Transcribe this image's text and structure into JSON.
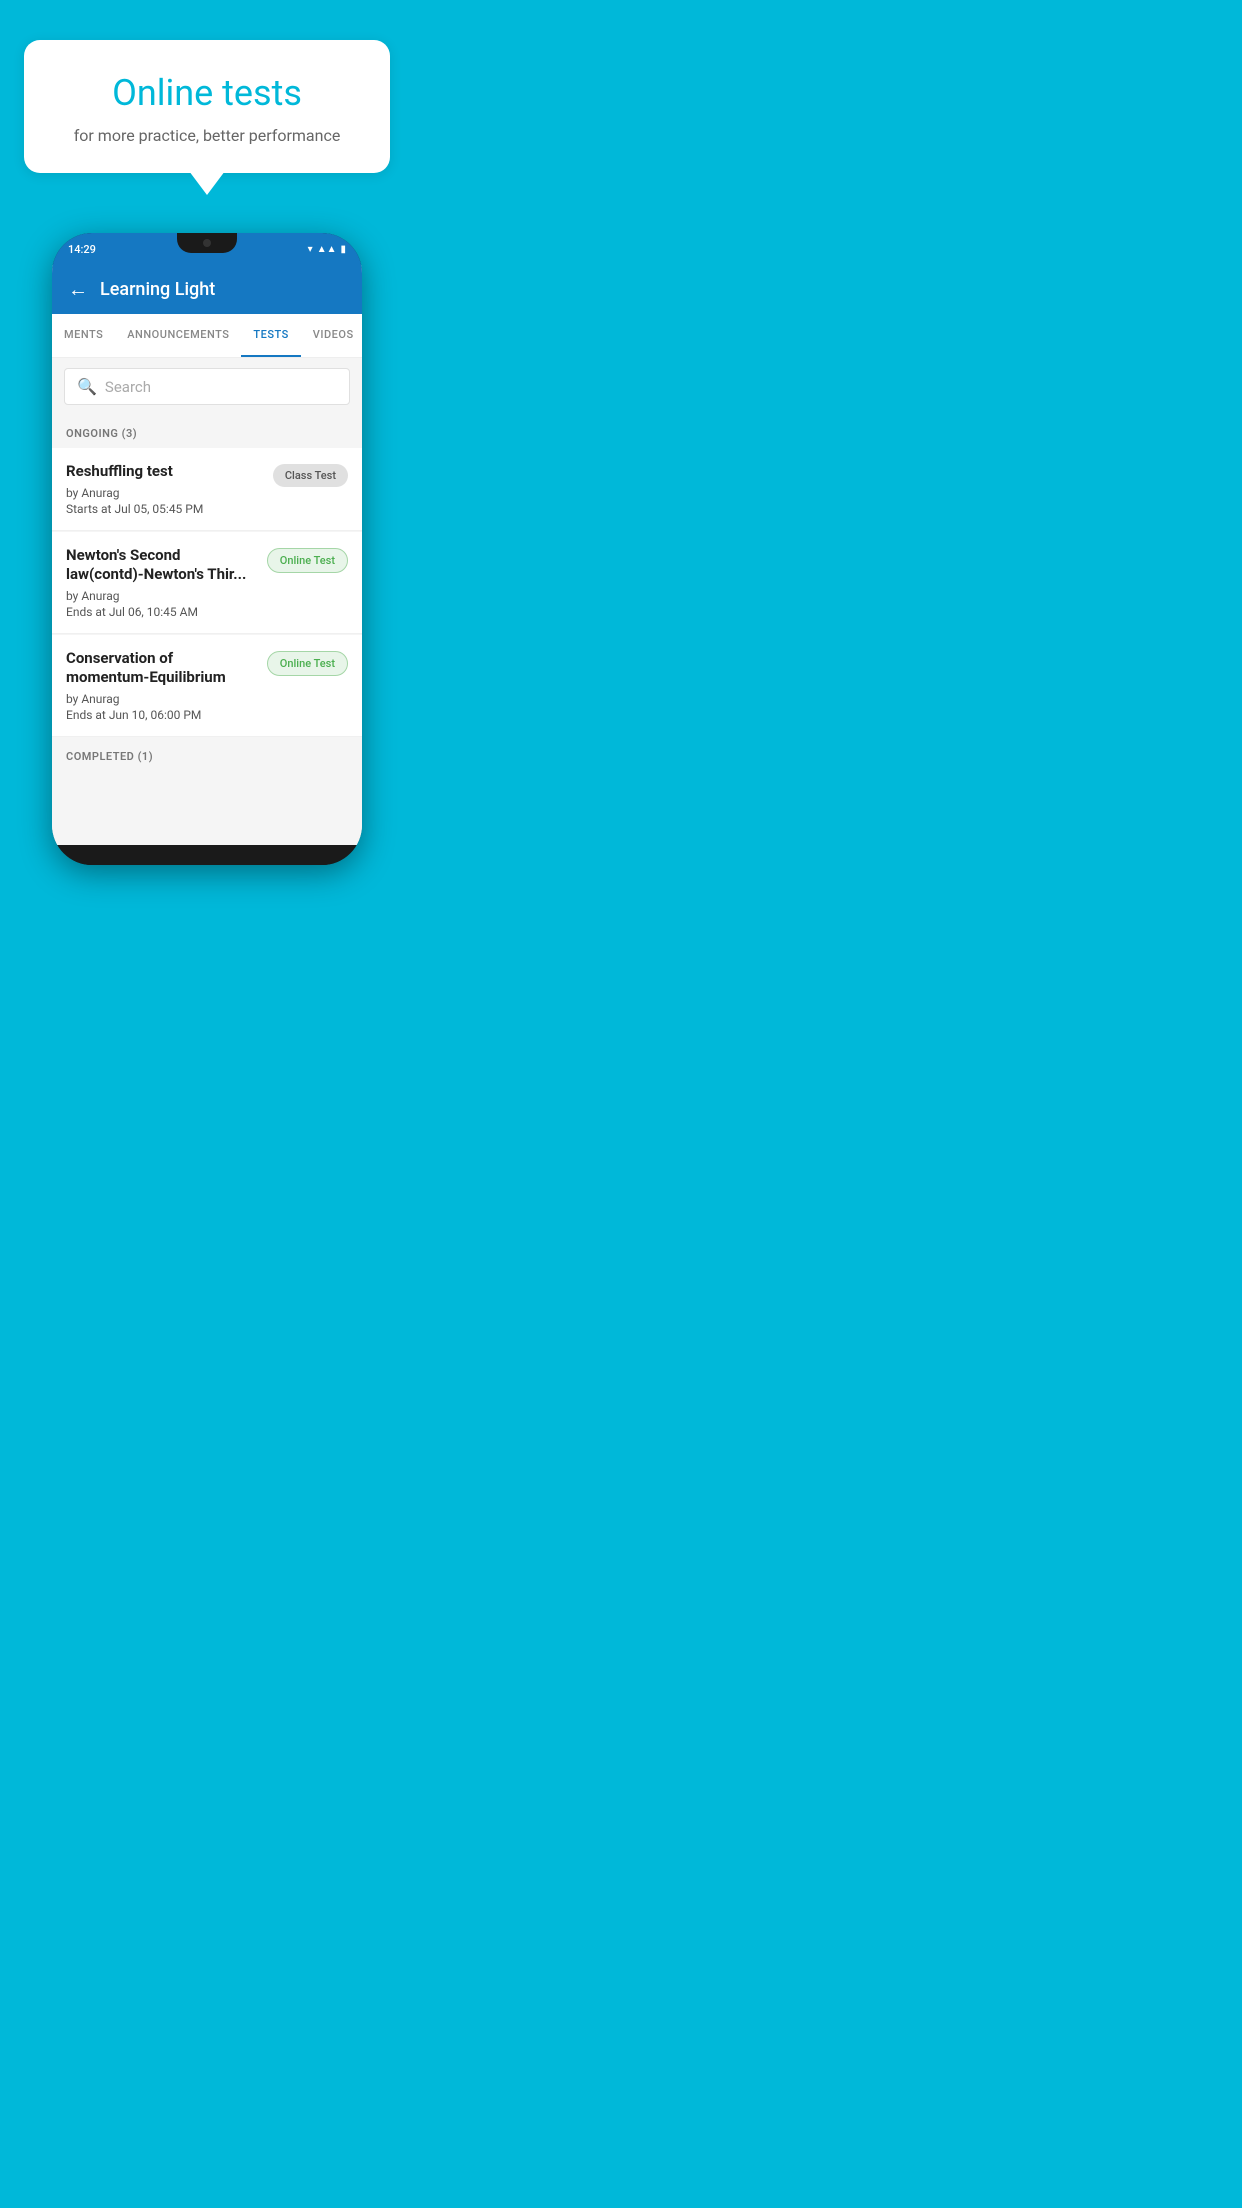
{
  "hero": {
    "bubble_title": "Online tests",
    "bubble_subtitle": "for more practice, better performance"
  },
  "phone": {
    "status_time": "14:29",
    "app_title": "Learning Light",
    "back_label": "←",
    "tabs": [
      {
        "label": "MENTS",
        "active": false
      },
      {
        "label": "ANNOUNCEMENTS",
        "active": false
      },
      {
        "label": "TESTS",
        "active": true
      },
      {
        "label": "VIDEOS",
        "active": false
      }
    ],
    "search_placeholder": "Search",
    "section_ongoing": "ONGOING (3)",
    "tests": [
      {
        "name": "Reshuffling test",
        "by": "by Anurag",
        "date": "Starts at  Jul 05, 05:45 PM",
        "badge": "Class Test",
        "badge_type": "class"
      },
      {
        "name": "Newton's Second law(contd)-Newton's Thir...",
        "by": "by Anurag",
        "date": "Ends at  Jul 06, 10:45 AM",
        "badge": "Online Test",
        "badge_type": "online"
      },
      {
        "name": "Conservation of momentum-Equilibrium",
        "by": "by Anurag",
        "date": "Ends at  Jun 10, 06:00 PM",
        "badge": "Online Test",
        "badge_type": "online"
      }
    ],
    "section_completed": "COMPLETED (1)"
  },
  "background_color": "#00B8D9"
}
